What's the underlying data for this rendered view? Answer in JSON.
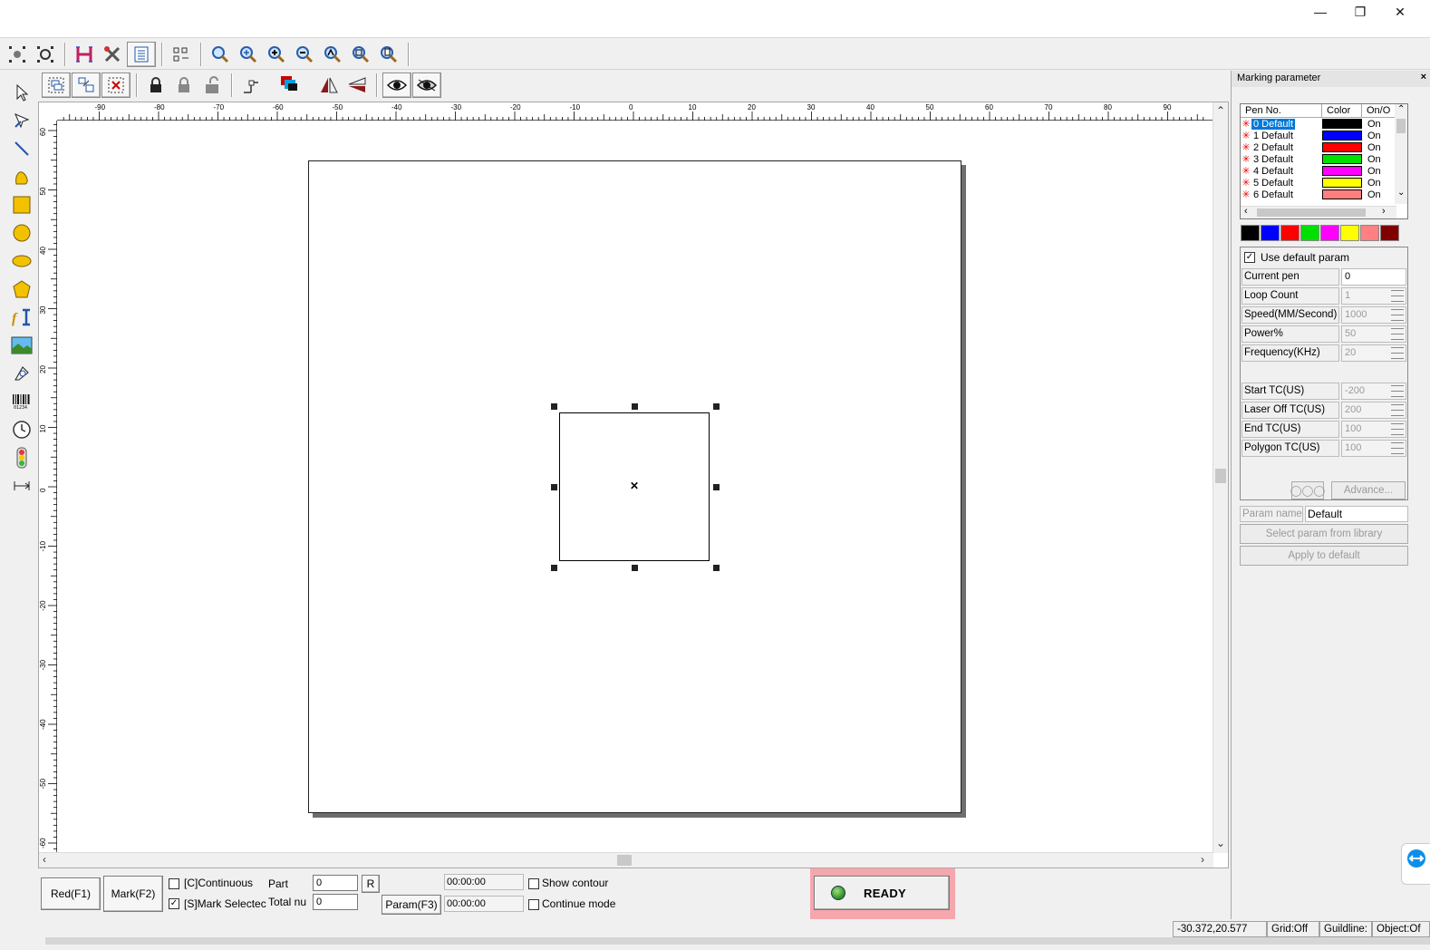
{
  "window": {
    "minimize_glyph": "—",
    "restore_glyph": "❐",
    "close_glyph": "✕"
  },
  "toolbar1": {
    "icons": [
      "select-all-icon",
      "select-invert-icon",
      "hatch-icon",
      "tools-icon",
      "list-icon",
      "distribute-icon",
      "zoom-icon",
      "zoom-in-icon",
      "zoom-plus-icon",
      "zoom-minus-icon",
      "zoom-all-icon",
      "zoom-select-icon",
      "zoom-page-icon"
    ]
  },
  "toolbar2": {
    "icons": [
      "group-icon",
      "ungroup-icon",
      "delete-group-icon",
      "lock-icon",
      "unlock-icon",
      "unlock-all-icon",
      "node-icon",
      "color-layer-icon",
      "mirror-horizontal-icon",
      "mirror-vertical-icon",
      "show-icon",
      "hide-icon"
    ]
  },
  "left_tools": [
    "pointer-icon",
    "node-edit-icon",
    "line-icon",
    "curve-icon",
    "rectangle-icon",
    "circle-icon",
    "ellipse-icon",
    "polygon-icon",
    "text-icon",
    "image-icon",
    "vector-file-icon",
    "barcode-icon",
    "timer-icon",
    "io-port-icon",
    "extend-axis-icon"
  ],
  "ruler": {
    "h_ticks": [
      "-90",
      "-80",
      "-70",
      "-60",
      "-50",
      "-40",
      "-30",
      "-20",
      "-10",
      "0",
      "10",
      "20",
      "30",
      "40",
      "50",
      "60",
      "70",
      "80",
      "90"
    ],
    "v_ticks": [
      "60",
      "50",
      "40",
      "30",
      "20",
      "10",
      "0",
      "-10",
      "-20",
      "-30",
      "-40",
      "-50",
      "-60"
    ]
  },
  "marking_panel": {
    "title": "Marking parameter",
    "close": "×",
    "columns": [
      "Pen No.",
      "Color",
      "On/O"
    ],
    "pens": [
      {
        "no": "0 Default",
        "color": "#000000",
        "state": "On"
      },
      {
        "no": "1 Default",
        "color": "#0000ff",
        "state": "On"
      },
      {
        "no": "2 Default",
        "color": "#ff0000",
        "state": "On"
      },
      {
        "no": "3 Default",
        "color": "#00e000",
        "state": "On"
      },
      {
        "no": "4 Default",
        "color": "#ff00ff",
        "state": "On"
      },
      {
        "no": "5 Default",
        "color": "#ffff00",
        "state": "On"
      },
      {
        "no": "6 Default",
        "color": "#ff7f7f",
        "state": "On"
      }
    ],
    "palette": [
      "#000000",
      "#0000ff",
      "#ff0000",
      "#00e000",
      "#ff00ff",
      "#ffff00",
      "#ff8080",
      "#800000"
    ],
    "use_default": "Use default param",
    "params": [
      {
        "label": "Current pen",
        "value": "0"
      },
      {
        "label": "Loop Count",
        "value": "1"
      },
      {
        "label": "Speed(MM/Second)",
        "value": "1000"
      },
      {
        "label": "Power%",
        "value": "50"
      },
      {
        "label": "Frequency(KHz)",
        "value": "20"
      },
      {
        "label": "Start TC(US)",
        "value": "-200"
      },
      {
        "label": "Laser Off TC(US)",
        "value": "200"
      },
      {
        "label": "End TC(US)",
        "value": "100"
      },
      {
        "label": "Polygon TC(US)",
        "value": "100"
      }
    ],
    "wave_btn": "◯◯◯",
    "advance_btn": "Advance...",
    "param_name_label": "Param name",
    "param_name_value": "Default",
    "select_lib_btn": "Select param from library",
    "apply_default_btn": "Apply to default"
  },
  "bottom": {
    "red_btn": "Red(F1)",
    "mark_btn": "Mark(F2)",
    "continuous": "[C]Continuous",
    "mark_selected": "[S]Mark Selectec",
    "part_label": "Part",
    "part_value": "0",
    "r_btn": "R",
    "total_label": "Total nu",
    "total_value": "0",
    "param_btn": "Param(F3)",
    "time1": "00:00:00",
    "time2": "00:00:00",
    "show_contour": "Show contour",
    "continue_mode": "Continue mode",
    "status": "READY"
  },
  "statusbar": {
    "coords": "-30.372,20.577",
    "grid": "Grid:Off",
    "guideline": "Guildline:",
    "object": "Object:Of"
  }
}
